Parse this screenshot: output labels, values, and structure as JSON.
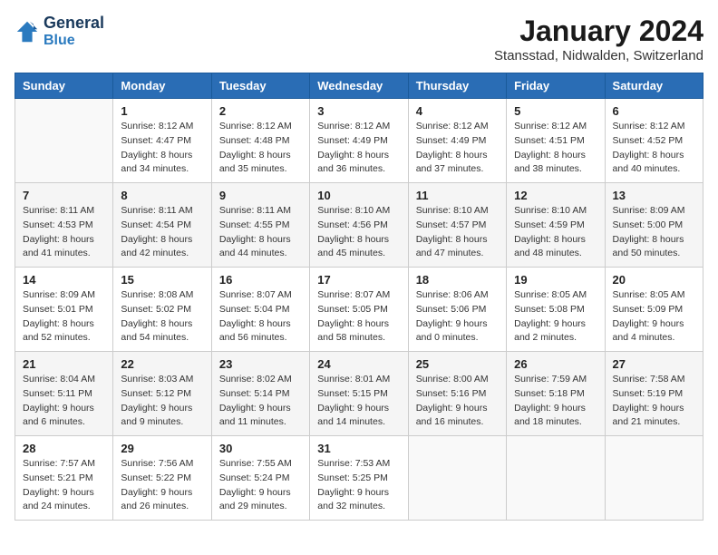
{
  "header": {
    "logo_line1": "General",
    "logo_line2": "Blue",
    "month": "January 2024",
    "location": "Stansstad, Nidwalden, Switzerland"
  },
  "columns": [
    "Sunday",
    "Monday",
    "Tuesday",
    "Wednesday",
    "Thursday",
    "Friday",
    "Saturday"
  ],
  "weeks": [
    [
      {
        "day": "",
        "sunrise": "",
        "sunset": "",
        "daylight": ""
      },
      {
        "day": "1",
        "sunrise": "Sunrise: 8:12 AM",
        "sunset": "Sunset: 4:47 PM",
        "daylight": "Daylight: 8 hours and 34 minutes."
      },
      {
        "day": "2",
        "sunrise": "Sunrise: 8:12 AM",
        "sunset": "Sunset: 4:48 PM",
        "daylight": "Daylight: 8 hours and 35 minutes."
      },
      {
        "day": "3",
        "sunrise": "Sunrise: 8:12 AM",
        "sunset": "Sunset: 4:49 PM",
        "daylight": "Daylight: 8 hours and 36 minutes."
      },
      {
        "day": "4",
        "sunrise": "Sunrise: 8:12 AM",
        "sunset": "Sunset: 4:49 PM",
        "daylight": "Daylight: 8 hours and 37 minutes."
      },
      {
        "day": "5",
        "sunrise": "Sunrise: 8:12 AM",
        "sunset": "Sunset: 4:51 PM",
        "daylight": "Daylight: 8 hours and 38 minutes."
      },
      {
        "day": "6",
        "sunrise": "Sunrise: 8:12 AM",
        "sunset": "Sunset: 4:52 PM",
        "daylight": "Daylight: 8 hours and 40 minutes."
      }
    ],
    [
      {
        "day": "7",
        "sunrise": "Sunrise: 8:11 AM",
        "sunset": "Sunset: 4:53 PM",
        "daylight": "Daylight: 8 hours and 41 minutes."
      },
      {
        "day": "8",
        "sunrise": "Sunrise: 8:11 AM",
        "sunset": "Sunset: 4:54 PM",
        "daylight": "Daylight: 8 hours and 42 minutes."
      },
      {
        "day": "9",
        "sunrise": "Sunrise: 8:11 AM",
        "sunset": "Sunset: 4:55 PM",
        "daylight": "Daylight: 8 hours and 44 minutes."
      },
      {
        "day": "10",
        "sunrise": "Sunrise: 8:10 AM",
        "sunset": "Sunset: 4:56 PM",
        "daylight": "Daylight: 8 hours and 45 minutes."
      },
      {
        "day": "11",
        "sunrise": "Sunrise: 8:10 AM",
        "sunset": "Sunset: 4:57 PM",
        "daylight": "Daylight: 8 hours and 47 minutes."
      },
      {
        "day": "12",
        "sunrise": "Sunrise: 8:10 AM",
        "sunset": "Sunset: 4:59 PM",
        "daylight": "Daylight: 8 hours and 48 minutes."
      },
      {
        "day": "13",
        "sunrise": "Sunrise: 8:09 AM",
        "sunset": "Sunset: 5:00 PM",
        "daylight": "Daylight: 8 hours and 50 minutes."
      }
    ],
    [
      {
        "day": "14",
        "sunrise": "Sunrise: 8:09 AM",
        "sunset": "Sunset: 5:01 PM",
        "daylight": "Daylight: 8 hours and 52 minutes."
      },
      {
        "day": "15",
        "sunrise": "Sunrise: 8:08 AM",
        "sunset": "Sunset: 5:02 PM",
        "daylight": "Daylight: 8 hours and 54 minutes."
      },
      {
        "day": "16",
        "sunrise": "Sunrise: 8:07 AM",
        "sunset": "Sunset: 5:04 PM",
        "daylight": "Daylight: 8 hours and 56 minutes."
      },
      {
        "day": "17",
        "sunrise": "Sunrise: 8:07 AM",
        "sunset": "Sunset: 5:05 PM",
        "daylight": "Daylight: 8 hours and 58 minutes."
      },
      {
        "day": "18",
        "sunrise": "Sunrise: 8:06 AM",
        "sunset": "Sunset: 5:06 PM",
        "daylight": "Daylight: 9 hours and 0 minutes."
      },
      {
        "day": "19",
        "sunrise": "Sunrise: 8:05 AM",
        "sunset": "Sunset: 5:08 PM",
        "daylight": "Daylight: 9 hours and 2 minutes."
      },
      {
        "day": "20",
        "sunrise": "Sunrise: 8:05 AM",
        "sunset": "Sunset: 5:09 PM",
        "daylight": "Daylight: 9 hours and 4 minutes."
      }
    ],
    [
      {
        "day": "21",
        "sunrise": "Sunrise: 8:04 AM",
        "sunset": "Sunset: 5:11 PM",
        "daylight": "Daylight: 9 hours and 6 minutes."
      },
      {
        "day": "22",
        "sunrise": "Sunrise: 8:03 AM",
        "sunset": "Sunset: 5:12 PM",
        "daylight": "Daylight: 9 hours and 9 minutes."
      },
      {
        "day": "23",
        "sunrise": "Sunrise: 8:02 AM",
        "sunset": "Sunset: 5:14 PM",
        "daylight": "Daylight: 9 hours and 11 minutes."
      },
      {
        "day": "24",
        "sunrise": "Sunrise: 8:01 AM",
        "sunset": "Sunset: 5:15 PM",
        "daylight": "Daylight: 9 hours and 14 minutes."
      },
      {
        "day": "25",
        "sunrise": "Sunrise: 8:00 AM",
        "sunset": "Sunset: 5:16 PM",
        "daylight": "Daylight: 9 hours and 16 minutes."
      },
      {
        "day": "26",
        "sunrise": "Sunrise: 7:59 AM",
        "sunset": "Sunset: 5:18 PM",
        "daylight": "Daylight: 9 hours and 18 minutes."
      },
      {
        "day": "27",
        "sunrise": "Sunrise: 7:58 AM",
        "sunset": "Sunset: 5:19 PM",
        "daylight": "Daylight: 9 hours and 21 minutes."
      }
    ],
    [
      {
        "day": "28",
        "sunrise": "Sunrise: 7:57 AM",
        "sunset": "Sunset: 5:21 PM",
        "daylight": "Daylight: 9 hours and 24 minutes."
      },
      {
        "day": "29",
        "sunrise": "Sunrise: 7:56 AM",
        "sunset": "Sunset: 5:22 PM",
        "daylight": "Daylight: 9 hours and 26 minutes."
      },
      {
        "day": "30",
        "sunrise": "Sunrise: 7:55 AM",
        "sunset": "Sunset: 5:24 PM",
        "daylight": "Daylight: 9 hours and 29 minutes."
      },
      {
        "day": "31",
        "sunrise": "Sunrise: 7:53 AM",
        "sunset": "Sunset: 5:25 PM",
        "daylight": "Daylight: 9 hours and 32 minutes."
      },
      {
        "day": "",
        "sunrise": "",
        "sunset": "",
        "daylight": ""
      },
      {
        "day": "",
        "sunrise": "",
        "sunset": "",
        "daylight": ""
      },
      {
        "day": "",
        "sunrise": "",
        "sunset": "",
        "daylight": ""
      }
    ]
  ]
}
